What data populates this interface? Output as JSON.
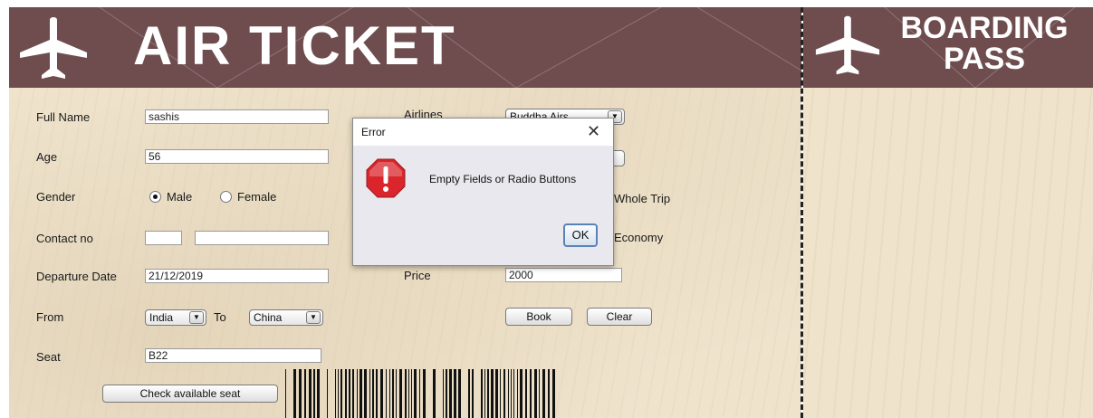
{
  "ticket": {
    "title": "AIR TICKET"
  },
  "boarding_pass": {
    "title_line1": "BOARDING",
    "title_line2": "PASS"
  },
  "form": {
    "full_name": {
      "label": "Full Name",
      "value": "sashis"
    },
    "age": {
      "label": "Age",
      "value": "56"
    },
    "gender": {
      "label": "Gender",
      "options": [
        "Male",
        "Female"
      ],
      "selected": "Male"
    },
    "contact": {
      "label": "Contact no",
      "code": "",
      "number": ""
    },
    "departure": {
      "label": "Departure Date",
      "value": "21/12/2019"
    },
    "route": {
      "label_from": "From",
      "from": "India",
      "label_to": "To",
      "to": "China"
    },
    "seat": {
      "label": "Seat",
      "value": "B22"
    },
    "check_seat_button": "Check available seat",
    "airlines": {
      "label": "Airlines",
      "value": "Buddha Airs"
    },
    "trip_option_visible": "Whole Trip",
    "class_option_visible": "Economy",
    "price": {
      "label": "Price",
      "value": "2000"
    },
    "book_button": "Book",
    "clear_button": "Clear"
  },
  "dialog": {
    "title": "Error",
    "message": "Empty Fields or Radio Buttons",
    "ok_label": "OK",
    "close_glyph": "✕"
  },
  "colors": {
    "header": "#6f4d4f",
    "paper": "#efe3cc",
    "error_red": "#d9252b"
  },
  "icons": [
    "airplane-icon",
    "error-icon",
    "close-icon",
    "chevron-down-icon",
    "barcode"
  ]
}
